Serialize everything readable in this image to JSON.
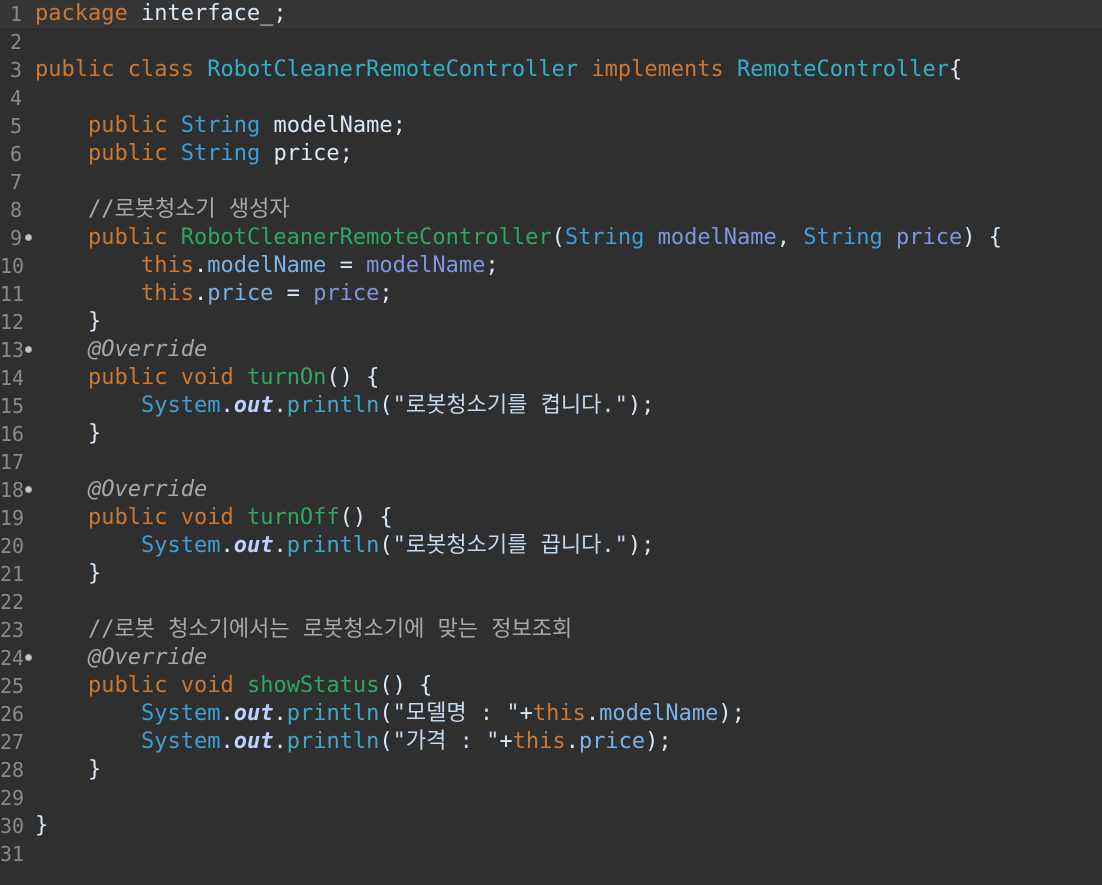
{
  "editor": {
    "language": "java",
    "colors": {
      "background": "#2f2f2f",
      "keyword": "#cc7832",
      "type": "#3f9fd6",
      "method": "#2ea764",
      "comment": "#a8a8a8"
    },
    "lines": [
      {
        "n": "1",
        "tokens": [
          [
            "kw",
            "package"
          ],
          [
            "plain",
            " interface_;"
          ]
        ],
        "current": true
      },
      {
        "n": "2",
        "tokens": []
      },
      {
        "n": "3",
        "tokens": [
          [
            "kw",
            "public"
          ],
          [
            "plain",
            " "
          ],
          [
            "kw",
            "class"
          ],
          [
            "plain",
            " "
          ],
          [
            "cls",
            "RobotCleanerRemoteController"
          ],
          [
            "plain",
            " "
          ],
          [
            "kw",
            "implements"
          ],
          [
            "plain",
            " "
          ],
          [
            "cls",
            "RemoteController"
          ],
          [
            "plain",
            "{"
          ]
        ]
      },
      {
        "n": "4",
        "tokens": []
      },
      {
        "n": "5",
        "tokens": [
          [
            "plain",
            "    "
          ],
          [
            "kw",
            "public"
          ],
          [
            "plain",
            " "
          ],
          [
            "ty",
            "String"
          ],
          [
            "plain",
            " modelName;"
          ]
        ]
      },
      {
        "n": "6",
        "tokens": [
          [
            "plain",
            "    "
          ],
          [
            "kw",
            "public"
          ],
          [
            "plain",
            " "
          ],
          [
            "ty",
            "String"
          ],
          [
            "plain",
            " price;"
          ]
        ]
      },
      {
        "n": "7",
        "tokens": []
      },
      {
        "n": "8",
        "tokens": [
          [
            "plain",
            "    "
          ],
          [
            "cmt",
            "//로봇청소기 생성자"
          ]
        ]
      },
      {
        "n": "9",
        "fold": true,
        "tokens": [
          [
            "plain",
            "    "
          ],
          [
            "kw",
            "public"
          ],
          [
            "plain",
            " "
          ],
          [
            "mth",
            "RobotCleanerRemoteController"
          ],
          [
            "plain",
            "("
          ],
          [
            "ty",
            "String"
          ],
          [
            "plain",
            " "
          ],
          [
            "prm",
            "modelName"
          ],
          [
            "plain",
            ", "
          ],
          [
            "ty",
            "String"
          ],
          [
            "plain",
            " "
          ],
          [
            "prm",
            "price"
          ],
          [
            "plain",
            ") {"
          ]
        ]
      },
      {
        "n": "10",
        "tokens": [
          [
            "plain",
            "        "
          ],
          [
            "kw",
            "this"
          ],
          [
            "plain",
            "."
          ],
          [
            "fld",
            "modelName"
          ],
          [
            "plain",
            " = "
          ],
          [
            "prm",
            "modelName"
          ],
          [
            "plain",
            ";"
          ]
        ]
      },
      {
        "n": "11",
        "tokens": [
          [
            "plain",
            "        "
          ],
          [
            "kw",
            "this"
          ],
          [
            "plain",
            "."
          ],
          [
            "fld",
            "price"
          ],
          [
            "plain",
            " = "
          ],
          [
            "prm",
            "price"
          ],
          [
            "plain",
            ";"
          ]
        ]
      },
      {
        "n": "12",
        "tokens": [
          [
            "plain",
            "    }"
          ]
        ]
      },
      {
        "n": "13",
        "fold": true,
        "tokens": [
          [
            "plain",
            "    "
          ],
          [
            "ann",
            "@Override"
          ]
        ]
      },
      {
        "n": "14",
        "tokens": [
          [
            "plain",
            "    "
          ],
          [
            "kw",
            "public"
          ],
          [
            "plain",
            " "
          ],
          [
            "kw",
            "void"
          ],
          [
            "plain",
            " "
          ],
          [
            "mth",
            "turnOn"
          ],
          [
            "plain",
            "() {"
          ]
        ]
      },
      {
        "n": "15",
        "tokens": [
          [
            "plain",
            "        "
          ],
          [
            "sys",
            "System"
          ],
          [
            "plain",
            "."
          ],
          [
            "out",
            "out"
          ],
          [
            "plain",
            "."
          ],
          [
            "println",
            "println"
          ],
          [
            "plain",
            "("
          ],
          [
            "str",
            "\"로봇청소기를 켭니다.\""
          ],
          [
            "plain",
            ");"
          ]
        ]
      },
      {
        "n": "16",
        "tokens": [
          [
            "plain",
            "    }"
          ]
        ]
      },
      {
        "n": "17",
        "tokens": []
      },
      {
        "n": "18",
        "fold": true,
        "tokens": [
          [
            "plain",
            "    "
          ],
          [
            "ann",
            "@Override"
          ]
        ]
      },
      {
        "n": "19",
        "tokens": [
          [
            "plain",
            "    "
          ],
          [
            "kw",
            "public"
          ],
          [
            "plain",
            " "
          ],
          [
            "kw",
            "void"
          ],
          [
            "plain",
            " "
          ],
          [
            "mth",
            "turnOff"
          ],
          [
            "plain",
            "() {"
          ]
        ]
      },
      {
        "n": "20",
        "tokens": [
          [
            "plain",
            "        "
          ],
          [
            "sys",
            "System"
          ],
          [
            "plain",
            "."
          ],
          [
            "out",
            "out"
          ],
          [
            "plain",
            "."
          ],
          [
            "println",
            "println"
          ],
          [
            "plain",
            "("
          ],
          [
            "str",
            "\"로봇청소기를 끕니다.\""
          ],
          [
            "plain",
            ");"
          ]
        ]
      },
      {
        "n": "21",
        "tokens": [
          [
            "plain",
            "    }"
          ]
        ]
      },
      {
        "n": "22",
        "tokens": []
      },
      {
        "n": "23",
        "tokens": [
          [
            "plain",
            "    "
          ],
          [
            "cmt",
            "//로봇 청소기에서는 로봇청소기에 맞는 정보조회"
          ]
        ]
      },
      {
        "n": "24",
        "fold": true,
        "tokens": [
          [
            "plain",
            "    "
          ],
          [
            "ann",
            "@Override"
          ]
        ]
      },
      {
        "n": "25",
        "tokens": [
          [
            "plain",
            "    "
          ],
          [
            "kw",
            "public"
          ],
          [
            "plain",
            " "
          ],
          [
            "kw",
            "void"
          ],
          [
            "plain",
            " "
          ],
          [
            "mth",
            "showStatus"
          ],
          [
            "plain",
            "() {"
          ]
        ]
      },
      {
        "n": "26",
        "tokens": [
          [
            "plain",
            "        "
          ],
          [
            "sys",
            "System"
          ],
          [
            "plain",
            "."
          ],
          [
            "out",
            "out"
          ],
          [
            "plain",
            "."
          ],
          [
            "println",
            "println"
          ],
          [
            "plain",
            "("
          ],
          [
            "str",
            "\"모델명 : \""
          ],
          [
            "plain",
            "+"
          ],
          [
            "kw",
            "this"
          ],
          [
            "plain",
            "."
          ],
          [
            "fld",
            "modelName"
          ],
          [
            "plain",
            ");"
          ]
        ]
      },
      {
        "n": "27",
        "tokens": [
          [
            "plain",
            "        "
          ],
          [
            "sys",
            "System"
          ],
          [
            "plain",
            "."
          ],
          [
            "out",
            "out"
          ],
          [
            "plain",
            "."
          ],
          [
            "println",
            "println"
          ],
          [
            "plain",
            "("
          ],
          [
            "str",
            "\"가격 : \""
          ],
          [
            "plain",
            "+"
          ],
          [
            "kw",
            "this"
          ],
          [
            "plain",
            "."
          ],
          [
            "fld",
            "price"
          ],
          [
            "plain",
            ");"
          ]
        ]
      },
      {
        "n": "28",
        "tokens": [
          [
            "plain",
            "    }"
          ]
        ]
      },
      {
        "n": "29",
        "tokens": []
      },
      {
        "n": "30",
        "tokens": [
          [
            "plain",
            "}"
          ]
        ]
      },
      {
        "n": "31",
        "tokens": []
      }
    ]
  }
}
